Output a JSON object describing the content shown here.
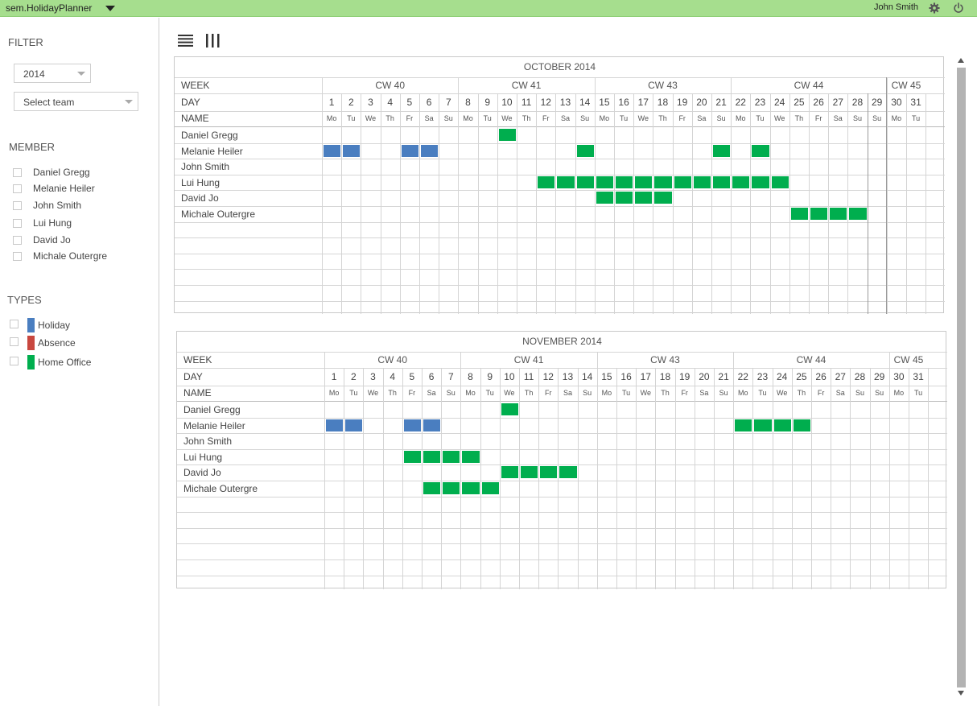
{
  "app": {
    "title": "sem.HolidayPlanner",
    "user": "John Smith"
  },
  "colors": {
    "topbar": "#a6de8e",
    "holiday": "#4a7ec0",
    "absence": "#c8473f",
    "home_office": "#00ae4e"
  },
  "filter": {
    "title": "FILTER",
    "year": "2014",
    "team_placeholder": "Select team"
  },
  "member_section": {
    "title": "MEMBER",
    "members": [
      "Daniel Gregg",
      "Melanie Heiler",
      "John Smith",
      "Lui Hung",
      "David Jo",
      "Michale Outergre"
    ]
  },
  "types_section": {
    "title": "TYPES",
    "types": [
      {
        "label": "Holiday",
        "color": "#4a7ec0"
      },
      {
        "label": "Absence",
        "color": "#c8473f"
      },
      {
        "label": "Home Office",
        "color": "#00ae4e"
      }
    ]
  },
  "grid_labels": {
    "week": "WEEK",
    "day": "DAY",
    "name": "NAME"
  },
  "calendars": [
    {
      "title": "OCTOBER 2014",
      "weeks": [
        {
          "label": "CW 40",
          "start": 1,
          "end": 7
        },
        {
          "label": "CW 41",
          "start": 8,
          "end": 14
        },
        {
          "label": "CW 43",
          "start": 15,
          "end": 21
        },
        {
          "label": "CW 44",
          "start": 22,
          "end": 29
        },
        {
          "label": "CW 45",
          "start": 30,
          "end": 31
        }
      ],
      "days": [
        "1",
        "2",
        "3",
        "4",
        "5",
        "6",
        "7",
        "8",
        "9",
        "10",
        "11",
        "12",
        "13",
        "14",
        "15",
        "16",
        "17",
        "18",
        "19",
        "20",
        "21",
        "22",
        "23",
        "24",
        "25",
        "26",
        "27",
        "28",
        "29",
        "30",
        "31"
      ],
      "day_names": [
        "Mo",
        "Tu",
        "We",
        "Th",
        "Fr",
        "Sa",
        "Su",
        "Mo",
        "Tu",
        "We",
        "Th",
        "Fr",
        "Sa",
        "Su",
        "Mo",
        "Tu",
        "We",
        "Th",
        "Fr",
        "Sa",
        "Su",
        "Mo",
        "Tu",
        "We",
        "Th",
        "Fr",
        "Sa",
        "Su",
        "Su",
        "Mo",
        "Tu"
      ],
      "members": [
        "Daniel Gregg",
        "Melanie Heiler",
        "John Smith",
        "Lui Hung",
        "David Jo",
        "Michale Outergre"
      ],
      "entries": [
        {
          "member": 0,
          "type": "home_office",
          "days": [
            10
          ]
        },
        {
          "member": 1,
          "type": "holiday",
          "days": [
            1,
            2,
            5,
            6
          ]
        },
        {
          "member": 1,
          "type": "home_office",
          "days": [
            14,
            21,
            23
          ]
        },
        {
          "member": 3,
          "type": "home_office",
          "days": [
            12,
            13,
            14,
            15,
            16,
            17,
            18,
            19,
            20,
            21,
            22,
            23,
            24
          ]
        },
        {
          "member": 4,
          "type": "home_office",
          "days": [
            15,
            16,
            17,
            18
          ]
        },
        {
          "member": 5,
          "type": "home_office",
          "days": [
            25,
            26,
            27,
            28
          ]
        }
      ]
    },
    {
      "title": "NOVEMBER 2014",
      "weeks": [
        {
          "label": "CW 40",
          "start": 1,
          "end": 7
        },
        {
          "label": "CW 41",
          "start": 8,
          "end": 14
        },
        {
          "label": "CW 43",
          "start": 15,
          "end": 21
        },
        {
          "label": "CW 44",
          "start": 22,
          "end": 29
        },
        {
          "label": "CW 45",
          "start": 30,
          "end": 31
        }
      ],
      "days": [
        "1",
        "2",
        "3",
        "4",
        "5",
        "6",
        "7",
        "8",
        "9",
        "10",
        "11",
        "12",
        "13",
        "14",
        "15",
        "16",
        "17",
        "18",
        "19",
        "20",
        "21",
        "22",
        "23",
        "24",
        "25",
        "26",
        "27",
        "28",
        "29",
        "30",
        "31"
      ],
      "day_names": [
        "Mo",
        "Tu",
        "We",
        "Th",
        "Fr",
        "Sa",
        "Su",
        "Mo",
        "Tu",
        "We",
        "Th",
        "Fr",
        "Sa",
        "Su",
        "Mo",
        "Tu",
        "We",
        "Th",
        "Fr",
        "Sa",
        "Su",
        "Mo",
        "Tu",
        "We",
        "Th",
        "Fr",
        "Sa",
        "Su",
        "Su",
        "Mo",
        "Tu"
      ],
      "members": [
        "Daniel Gregg",
        "Melanie Heiler",
        "John Smith",
        "Lui Hung",
        "David Jo",
        "Michale Outergre"
      ],
      "entries": [
        {
          "member": 0,
          "type": "home_office",
          "days": [
            10
          ]
        },
        {
          "member": 1,
          "type": "holiday",
          "days": [
            1,
            2,
            5,
            6
          ]
        },
        {
          "member": 1,
          "type": "home_office",
          "days": [
            22,
            23,
            24,
            25
          ]
        },
        {
          "member": 3,
          "type": "home_office",
          "days": [
            5,
            6,
            7,
            8
          ]
        },
        {
          "member": 4,
          "type": "home_office",
          "days": [
            10,
            11,
            12,
            13
          ]
        },
        {
          "member": 5,
          "type": "home_office",
          "days": [
            6,
            7,
            8,
            9
          ]
        }
      ]
    }
  ]
}
